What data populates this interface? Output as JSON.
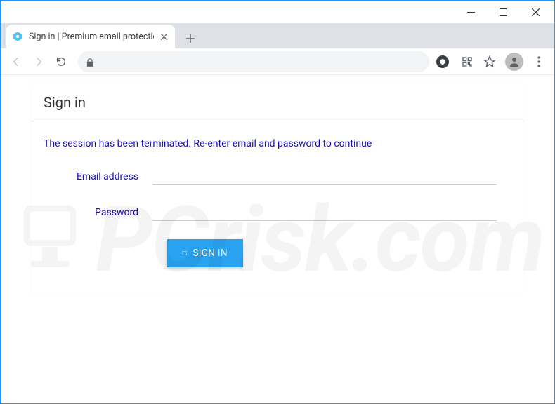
{
  "window": {
    "tab_title": "Sign in | Premium email protectio"
  },
  "omnibox": {
    "url": ""
  },
  "card": {
    "title": "Sign in",
    "message": "The session has been terminated. Re-enter email and password to continue",
    "email_label": "Email address",
    "password_label": "Password",
    "button_label": "SIGN IN"
  },
  "watermark": {
    "text": "PCrisk.com"
  }
}
